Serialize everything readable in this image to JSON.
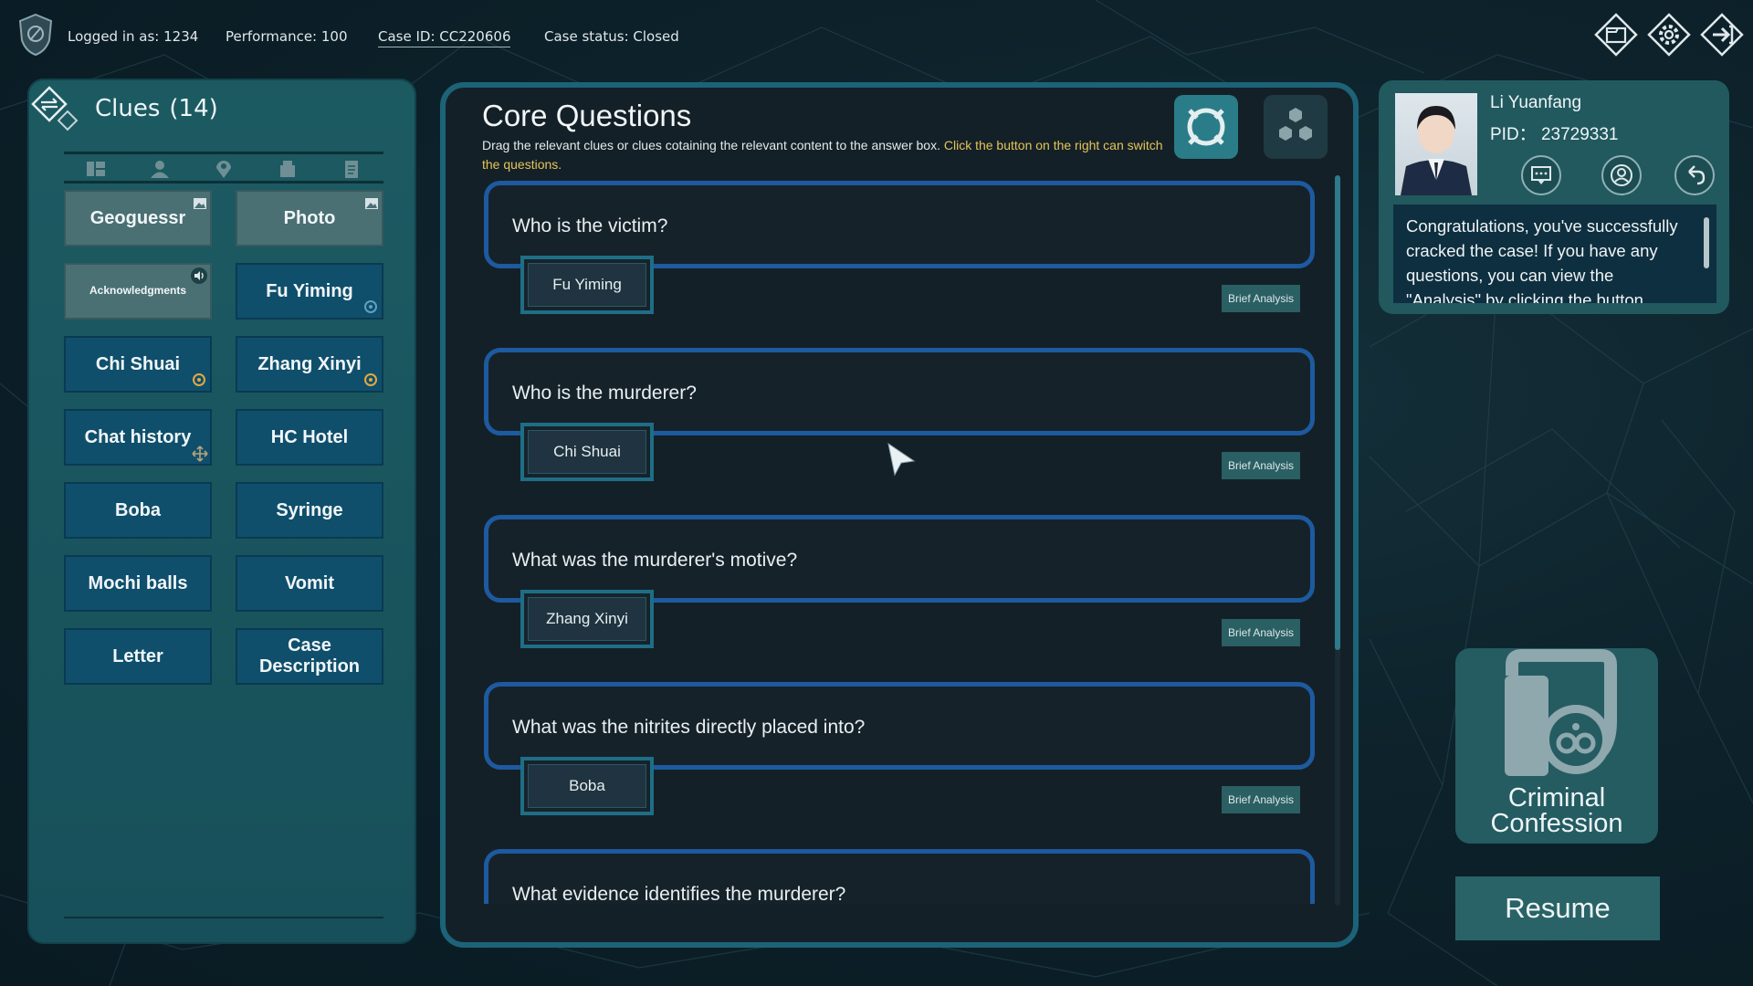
{
  "topbar": {
    "logged_in": "Logged in as: 1234",
    "performance": "Performance: 100",
    "case_id": "Case ID: CC220606",
    "case_status": "Case status: Closed",
    "icons": [
      "case-file-icon",
      "settings-gear-icon",
      "exit-icon"
    ]
  },
  "clues": {
    "title": "Clues",
    "count": "(14)",
    "filters": [
      "all-clues-icon",
      "person-icon",
      "location-icon",
      "object-icon",
      "document-icon"
    ],
    "items": [
      {
        "label": "Geoguessr",
        "badge": "image-icon",
        "style": "gray"
      },
      {
        "label": "Photo",
        "badge": "image-icon",
        "style": "gray"
      },
      {
        "label": "Acknowledgments",
        "badge": "audio-icon",
        "style": "gray"
      },
      {
        "label": "Fu Yiming",
        "badge": "eye-icon",
        "style": "blue"
      },
      {
        "label": "Chi Shuai",
        "badge": "eye-icon",
        "style": "blue"
      },
      {
        "label": "Zhang Xinyi",
        "badge": "eye-icon",
        "style": "blue"
      },
      {
        "label": "Chat history",
        "badge": "move-icon",
        "style": "blue"
      },
      {
        "label": "HC Hotel",
        "badge": "",
        "style": "blue"
      },
      {
        "label": "Boba",
        "badge": "",
        "style": "blue"
      },
      {
        "label": "Syringe",
        "badge": "",
        "style": "blue"
      },
      {
        "label": "Mochi balls",
        "badge": "",
        "style": "blue"
      },
      {
        "label": "Vomit",
        "badge": "",
        "style": "blue"
      },
      {
        "label": "Letter",
        "badge": "",
        "style": "blue"
      },
      {
        "label": "Case Description",
        "badge": "",
        "style": "blue"
      }
    ]
  },
  "core": {
    "title": "Core Questions",
    "desc_main": "Drag the relevant clues or clues cotaining the relevant content to the answer box. ",
    "desc_highlight": "Click the button on the right can switch the questions.",
    "questions": [
      {
        "question": "Who is the victim?",
        "answer": "Fu Yiming",
        "analysis": "Brief Analysis"
      },
      {
        "question": "Who is the murderer?",
        "answer": "Chi Shuai",
        "analysis": "Brief Analysis"
      },
      {
        "question": "What was the murderer's motive?",
        "answer": "Zhang Xinyi",
        "analysis": "Brief Analysis"
      },
      {
        "question": "What was the nitrites directly placed into?",
        "answer": "Boba",
        "analysis": "Brief Analysis"
      },
      {
        "question": "What evidence identifies the murderer?",
        "answer": "",
        "analysis": ""
      }
    ]
  },
  "officer": {
    "name": "Li Yuanfang",
    "pid": "PID：  23729331",
    "message": "Congratulations, you've successfully cracked the case! If you have any questions, you can view the \"Analysis\" by clicking the button"
  },
  "confession": {
    "line1": "Criminal",
    "line2": "Confession"
  },
  "resume": "Resume",
  "colors": {
    "accent_blue": "#1d5aa0",
    "panel_teal": "#1c5a62",
    "highlight_yellow": "#e4c45a"
  }
}
